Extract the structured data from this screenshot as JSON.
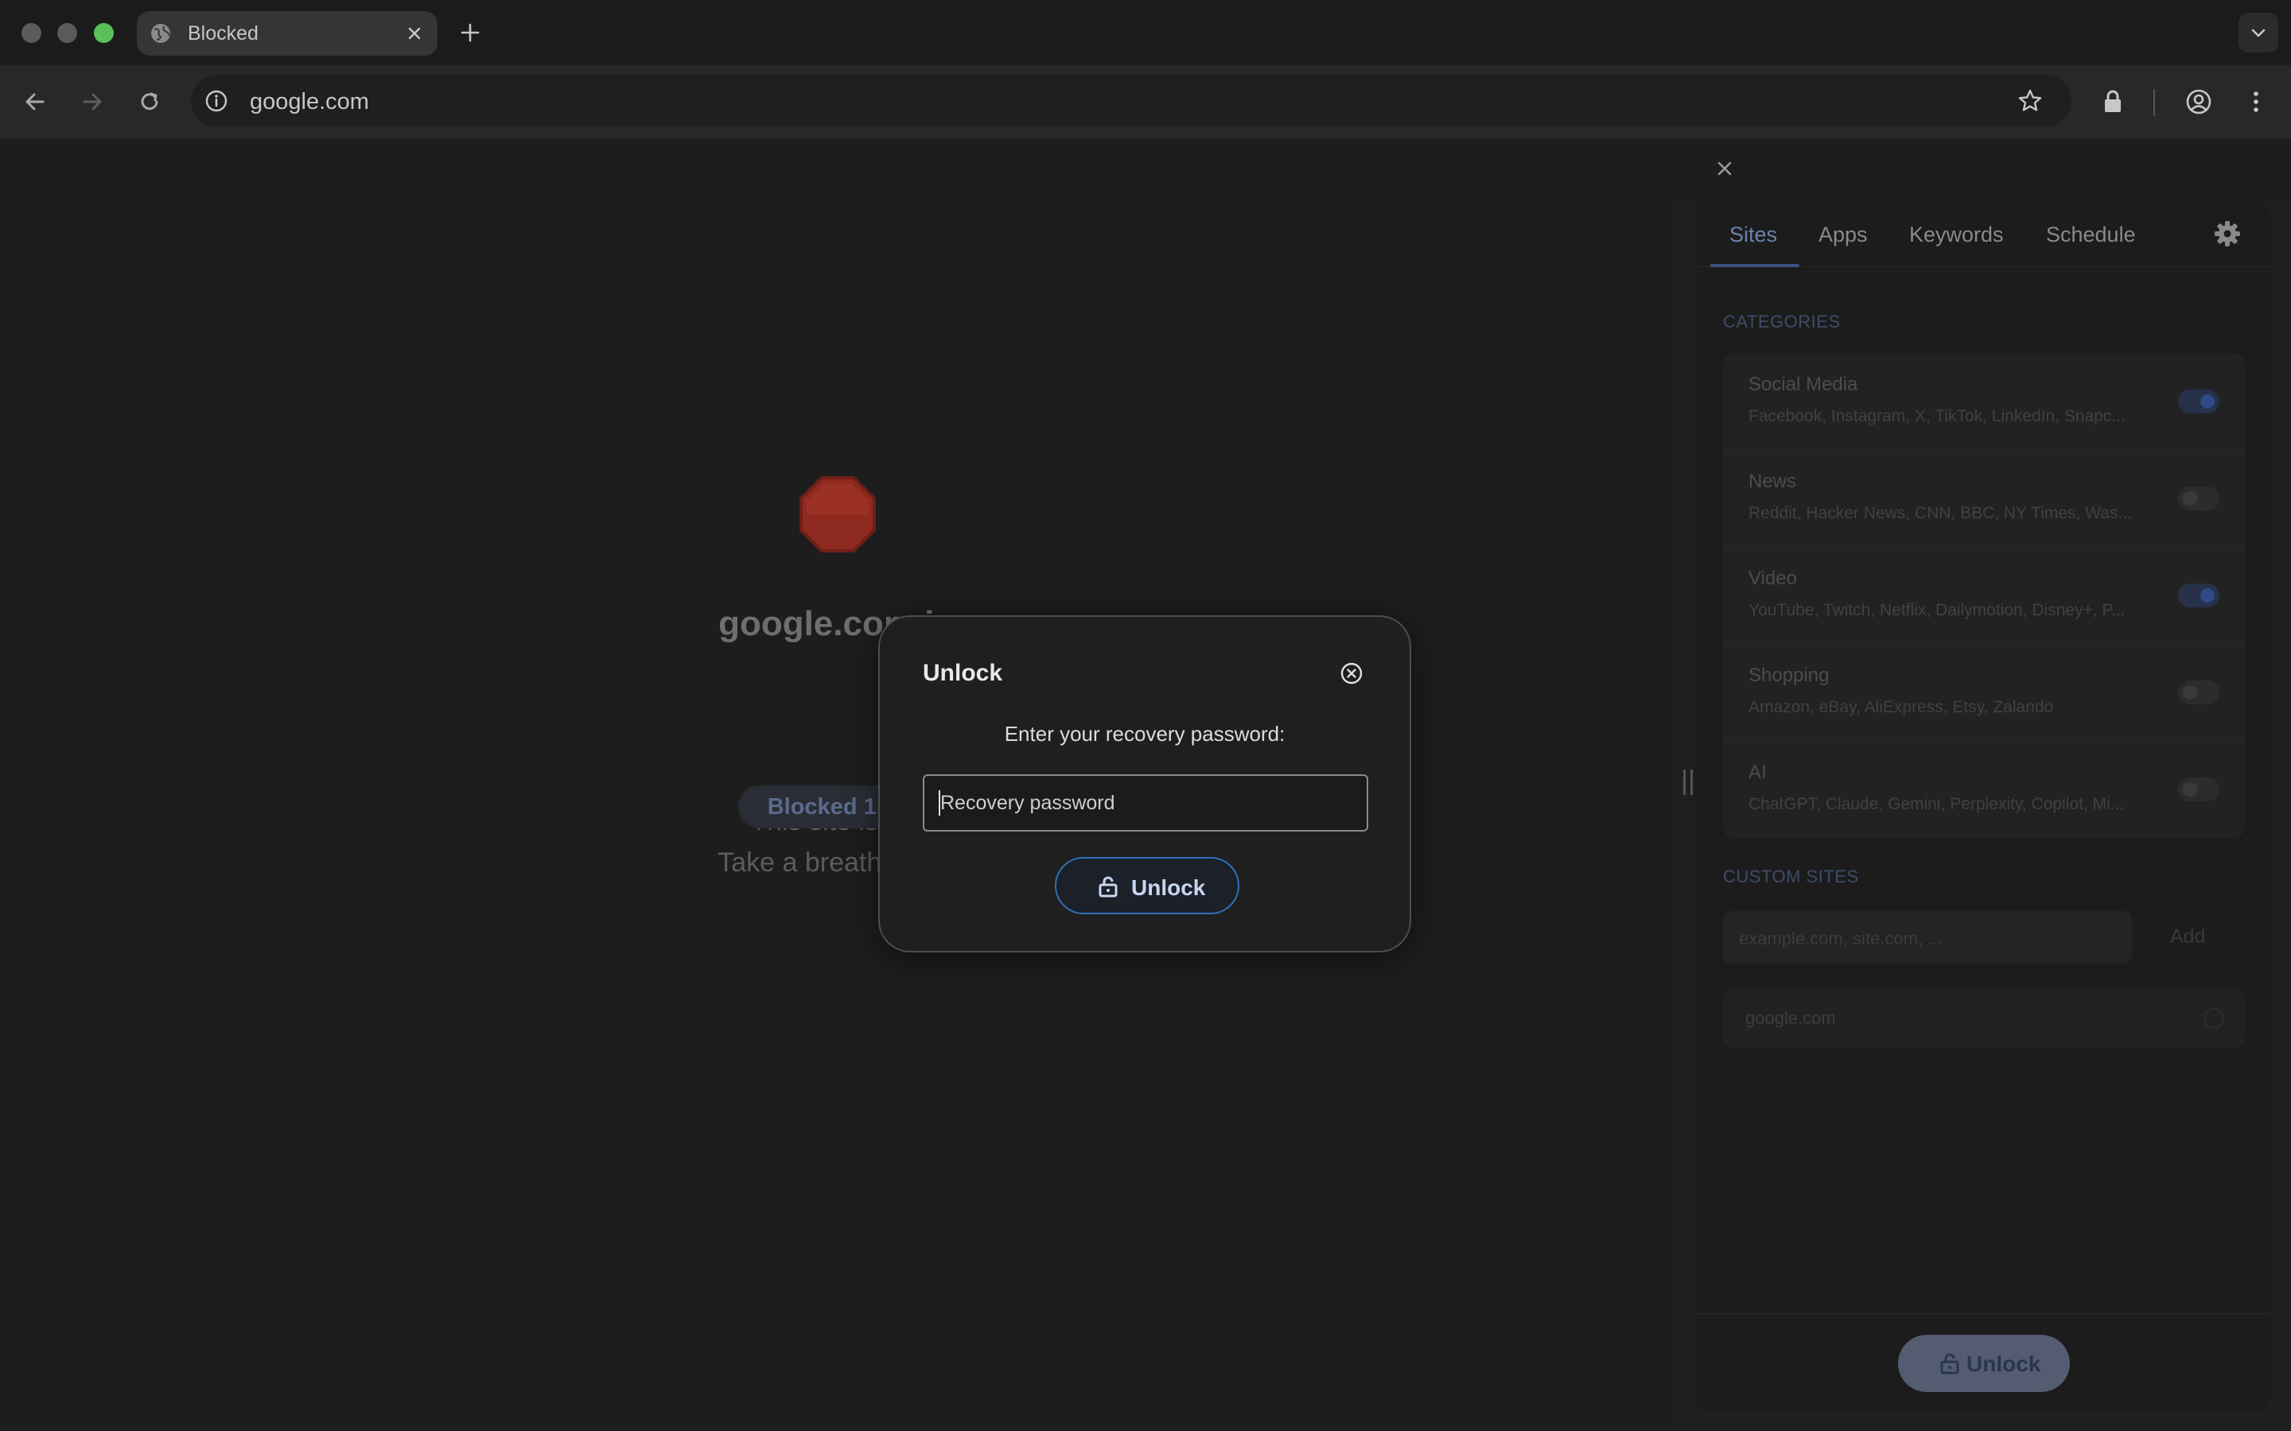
{
  "browser": {
    "tab": {
      "title": "Blocked"
    },
    "address": {
      "url": "google.com"
    }
  },
  "blocked_page": {
    "title": "google.com is",
    "line1": "This site is blo",
    "line2": "Take a breath, you'r",
    "counter": "Blocked 1 tim"
  },
  "side_panel": {
    "tabs": [
      {
        "label": "Sites"
      },
      {
        "label": "Apps"
      },
      {
        "label": "Keywords"
      },
      {
        "label": "Schedule"
      }
    ],
    "active_tab": "Sites",
    "categories_heading": "CATEGORIES",
    "categories": [
      {
        "name": "Social Media",
        "sites": "Facebook, Instagram, X, TikTok, LinkedIn, Snapc...",
        "enabled": true
      },
      {
        "name": "News",
        "sites": "Reddit, Hacker News, CNN, BBC, NY Times, Was...",
        "enabled": false
      },
      {
        "name": "Video",
        "sites": "YouTube, Twitch, Netflix, Dailymotion, Disney+, P...",
        "enabled": true
      },
      {
        "name": "Shopping",
        "sites": "Amazon, eBay, AliExpress, Etsy, Zalando",
        "enabled": false
      },
      {
        "name": "AI",
        "sites": "ChatGPT, Claude, Gemini, Perplexity, Copilot, Mi...",
        "enabled": false
      }
    ],
    "custom_heading": "CUSTOM SITES",
    "custom_placeholder": "example.com, site.com, ...",
    "add_label": "Add",
    "custom_sites": [
      {
        "domain": "google.com"
      }
    ],
    "footer_unlock_label": "Unlock"
  },
  "modal": {
    "title": "Unlock",
    "prompt": "Enter your recovery password:",
    "input_placeholder": "Recovery password",
    "button_label": "Unlock"
  },
  "colors": {
    "accent_blue": "#2f6fb4",
    "stop_red": "#8e2a1f",
    "traffic_close": "#5b5b5b",
    "traffic_min": "#5b5b5b",
    "traffic_max": "#5ac05a"
  }
}
